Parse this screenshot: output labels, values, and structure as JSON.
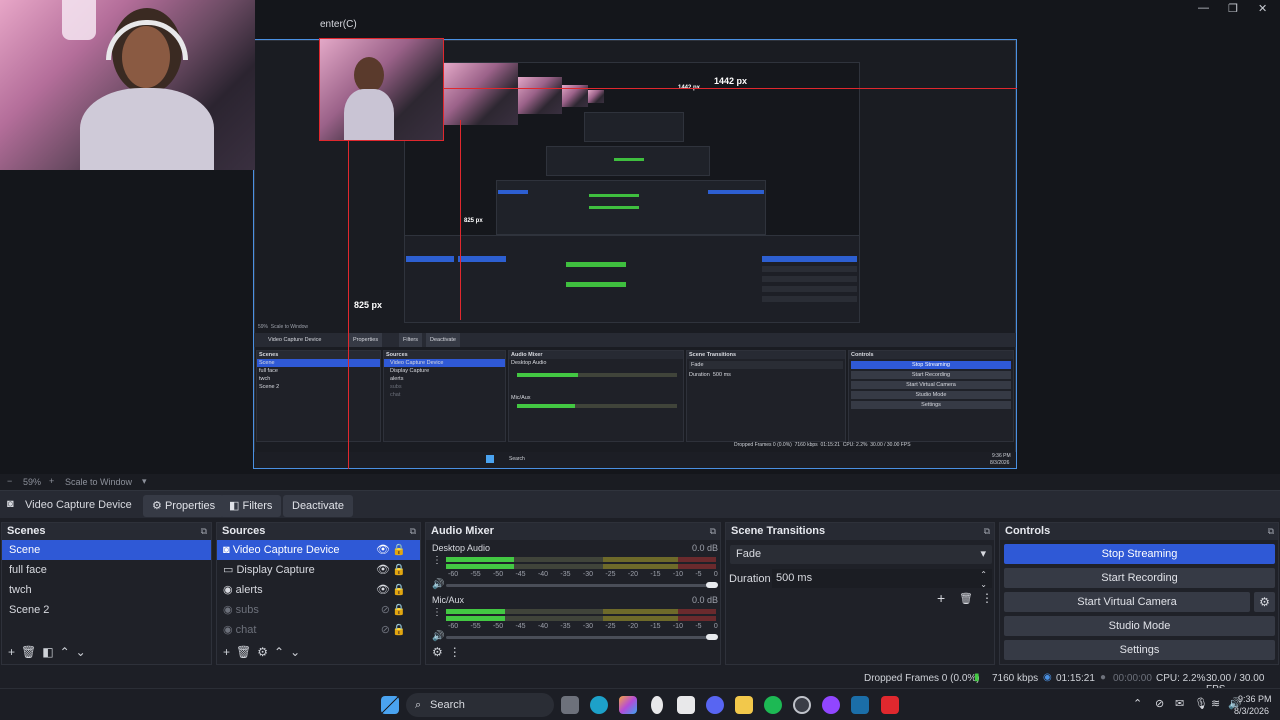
{
  "window": {
    "title_fragment": "enter(C)",
    "controls": [
      "—",
      "❐",
      "✕"
    ]
  },
  "preview": {
    "dim_label_width": "1442 px",
    "dim_label_height": "825 px",
    "inner_dim_width": "1442 px",
    "inner_dim_height": "825 px",
    "nested_toolbar": {
      "zoom": "59%",
      "scale": "Scale to Window",
      "source": "Video Capture Device",
      "properties": "Properties",
      "filters": "Filters",
      "deactivate": "Deactivate"
    },
    "nested_docks": {
      "scenes": "Scenes",
      "sources": "Sources",
      "mixer": "Audio Mixer",
      "transitions": "Scene Transitions",
      "controls": "Controls",
      "scene_items": [
        "Scene",
        "full face",
        "twch",
        "Scene 2"
      ],
      "source_items": [
        "Video Capture Device",
        "Display Capture",
        "alerts",
        "subs",
        "chat"
      ],
      "desktop_audio": "Desktop Audio",
      "mic_aux": "Mic/Aux",
      "fade": "Fade",
      "duration_label": "Duration",
      "duration": "500 ms",
      "buttons": [
        "Stop Streaming",
        "Start Recording",
        "Start Virtual Camera",
        "Studio Mode",
        "Settings"
      ],
      "status": "Dropped Frames 0 (0.0%)",
      "kbps": "7160 kbps",
      "time": "01:15:21",
      "cpu": "CPU: 2.2%",
      "fps": "30.00 / 30.00 FPS",
      "search": "Search",
      "clock": "9:36 PM",
      "date": "8/3/2026"
    }
  },
  "zoombar": {
    "minus": "−",
    "zoom": "59%",
    "plus": "+",
    "scale_mode": "Scale to Window"
  },
  "source_toolbar": {
    "source_name": "Video Capture Device",
    "properties": "Properties",
    "filters": "Filters",
    "deactivate": "Deactivate"
  },
  "scenes": {
    "title": "Scenes",
    "items": [
      "Scene",
      "full face",
      "twch",
      "Scene 2"
    ],
    "selected_index": 0
  },
  "sources": {
    "title": "Sources",
    "items": [
      {
        "label": "Video Capture Device",
        "icon": "camera-icon",
        "visible": true
      },
      {
        "label": "Display Capture",
        "icon": "monitor-icon",
        "visible": true
      },
      {
        "label": "alerts",
        "icon": "globe-icon",
        "visible": true
      },
      {
        "label": "subs",
        "icon": "globe-icon",
        "visible": false
      },
      {
        "label": "chat",
        "icon": "globe-icon",
        "visible": false
      }
    ]
  },
  "mixer": {
    "title": "Audio Mixer",
    "channels": [
      {
        "name": "Desktop Audio",
        "db": "0.0 dB",
        "level": 0.25
      },
      {
        "name": "Mic/Aux",
        "db": "0.0 dB",
        "level": 0.22
      }
    ],
    "scale": [
      "-60",
      "-55",
      "-50",
      "-45",
      "-40",
      "-35",
      "-30",
      "-25",
      "-20",
      "-15",
      "-10",
      "-5",
      "0"
    ]
  },
  "transitions": {
    "title": "Scene Transitions",
    "type": "Fade",
    "duration_label": "Duration",
    "duration": "500 ms"
  },
  "controls": {
    "title": "Controls",
    "stop_streaming": "Stop Streaming",
    "start_recording": "Start Recording",
    "start_virtual_camera": "Start Virtual Camera",
    "studio_mode": "Studio Mode",
    "settings": "Settings"
  },
  "status": {
    "dropped": "Dropped Frames 0 (0.0%)",
    "kbps": "7160 kbps",
    "live_time": "01:15:21",
    "rec_time": "00:00:00",
    "cpu": "CPU: 2.2%",
    "fps": "30.00 / 30.00 FPS"
  },
  "taskbar": {
    "search": "Search",
    "time": "9:36 PM",
    "date": "8/3/2026"
  },
  "colors": {
    "accent": "#2f59d6",
    "selection_border": "#4a90e2",
    "guide_red": "#e0282e",
    "meter_green": "#43c843"
  }
}
